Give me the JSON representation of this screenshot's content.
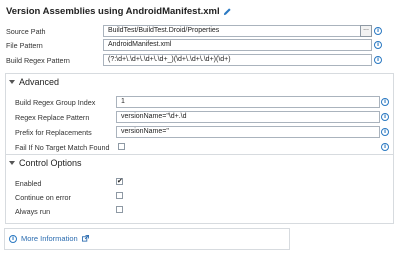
{
  "header": {
    "title": "Version Assemblies using AndroidManifest.xml",
    "edit_icon": "pencil-icon"
  },
  "fields": {
    "source_path": {
      "label": "Source Path",
      "value": "BuildTest/BuildTest.Droid/Properties",
      "browse": "..."
    },
    "file_pattern": {
      "label": "File Pattern",
      "value": "AndroidManifest.xml"
    },
    "build_regex": {
      "label": "Build Regex Pattern",
      "value": "(?:\\d+\\.\\d+\\.\\d+\\.\\d+_)(\\d+\\.\\d+\\.\\d+)(\\d+)"
    }
  },
  "advanced": {
    "title": "Advanced",
    "group_index": {
      "label": "Build Regex Group Index",
      "value": "1"
    },
    "replace_pattern": {
      "label": "Regex Replace Pattern",
      "value": "versionName=\"\\d+.\\d"
    },
    "prefix": {
      "label": "Prefix for Replacements",
      "value": "versionName=\""
    },
    "fail_no_match": {
      "label": "Fail If No Target Match Found",
      "checked": false
    }
  },
  "control_options": {
    "title": "Control Options",
    "enabled": {
      "label": "Enabled",
      "checked": true
    },
    "continue_on_error": {
      "label": "Continue on error",
      "checked": false
    },
    "always_run": {
      "label": "Always run",
      "checked": false
    }
  },
  "footer": {
    "more_info": "More Information",
    "info_glyph": "i",
    "checkmark": "✔"
  },
  "colors": {
    "accent": "#2b79c2",
    "link": "#2b6cb0",
    "border": "#d7dbdf"
  }
}
